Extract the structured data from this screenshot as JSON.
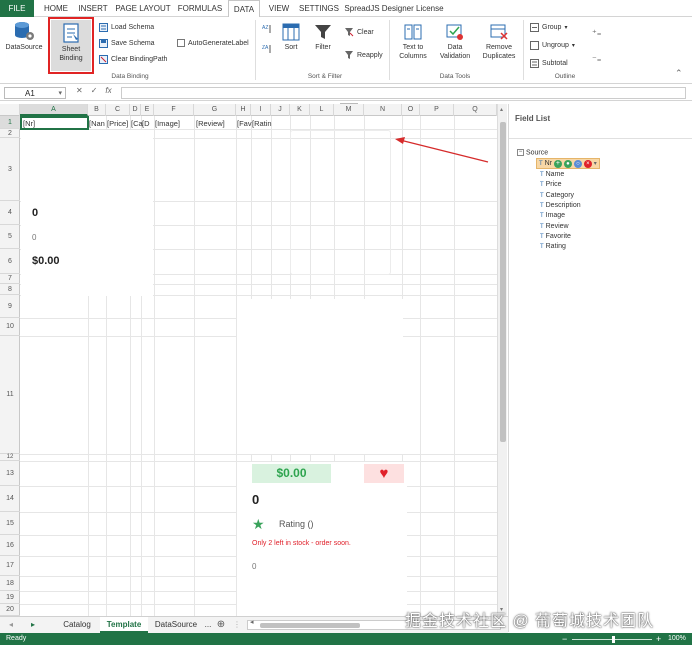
{
  "ribbon_tabs": [
    {
      "label": "FILE"
    },
    {
      "label": "HOME"
    },
    {
      "label": "INSERT"
    },
    {
      "label": "PAGE LAYOUT"
    },
    {
      "label": "FORMULAS"
    },
    {
      "label": "DATA"
    },
    {
      "label": "VIEW"
    },
    {
      "label": "SETTINGS"
    },
    {
      "label": "SpreadJS Designer License"
    }
  ],
  "ribbon": {
    "datasource": "DataSource",
    "sheet_binding_l1": "Sheet",
    "sheet_binding_l2": "Binding",
    "load_schema": "Load Schema",
    "save_schema": "Save Schema",
    "clear_binding_path": "Clear BindingPath",
    "auto_generate_label": "AutoGenerateLabel",
    "group_data_binding": "Data Binding",
    "sort": "Sort",
    "filter": "Filter",
    "clear": "Clear",
    "reapply": "Reapply",
    "group_sort_filter": "Sort & Filter",
    "text_to_columns_l1": "Text to",
    "text_to_columns_l2": "Columns",
    "data_validation_l1": "Data",
    "data_validation_l2": "Validation",
    "remove_duplicates_l1": "Remove",
    "remove_duplicates_l2": "Duplicates",
    "group_data_tools": "Data Tools",
    "group": "Group",
    "ungroup": "Ungroup",
    "subtotal": "Subtotal",
    "group_outline": "Outline"
  },
  "formula_bar": {
    "name_box": "A1",
    "fx": "fx"
  },
  "columns": [
    "A",
    "B",
    "C",
    "D",
    "E",
    "F",
    "G",
    "H",
    "I",
    "J",
    "K",
    "L",
    "M",
    "N",
    "O",
    "P",
    "Q"
  ],
  "rows": [
    "1",
    "2",
    "3",
    "4",
    "5",
    "6",
    "7",
    "8",
    "9",
    "10",
    "11",
    "12",
    "13",
    "14",
    "15",
    "16",
    "17",
    "18",
    "19",
    "20"
  ],
  "cells": {
    "a1": "[Nr]",
    "b1": "[Nan",
    "c1": "[Price]",
    "d1": "[Ca",
    "e1": "[D",
    "f1": "[Image]",
    "g1": "[Review]",
    "h1": "[Fav",
    "i1": "[Ratin",
    "a4": "0",
    "a5": "0",
    "a6": "$0.00",
    "price_badge": "$0.00",
    "heart": "♥",
    "count": "0",
    "rating": "Rating ()",
    "stock_note": "Only 2 left in stock - order soon.",
    "bottom_zero": "0"
  },
  "field_list": {
    "title": "Field List",
    "root": "Source",
    "selected": "Nr",
    "fields": [
      "Name",
      "Price",
      "Category",
      "Description",
      "Image",
      "Review",
      "Favorite",
      "Rating"
    ]
  },
  "sheet_tabs": [
    "Catalog",
    "Template",
    "DataSource"
  ],
  "active_sheet": "Template",
  "more_tabs": "...",
  "status": {
    "ready": "Ready",
    "zoom": "100%"
  },
  "watermark": "掘金技术社区 @ 葡萄城技术团队",
  "colors": {
    "excel_green": "#217346",
    "price_badge_bg": "#d9f2df",
    "price_badge_text": "#2ea44f",
    "heart_bg": "#fde0e0",
    "heart": "#e0202a",
    "star": "#3aa35c",
    "stock_note": "#e0202a",
    "arrow": "#d62b2b",
    "highlight_box": "#e02424"
  }
}
